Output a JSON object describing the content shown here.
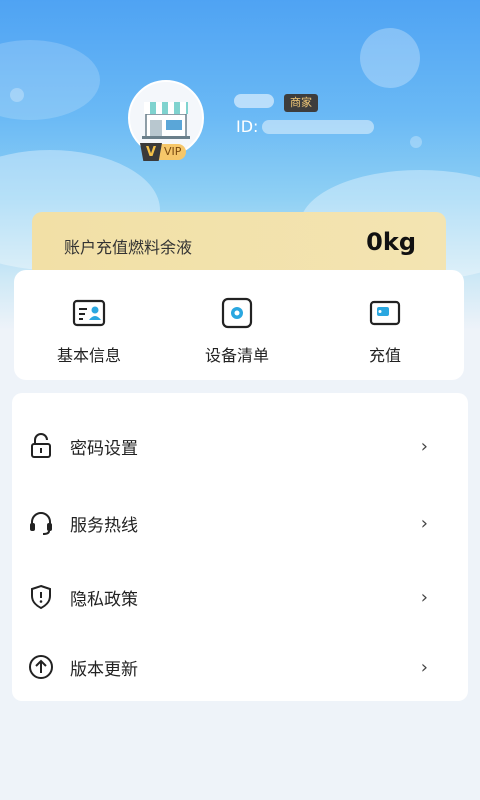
{
  "profile": {
    "role_tag": "商家",
    "id_label": "ID:",
    "vip_text": "VIP",
    "vip_letter": "V"
  },
  "fuel": {
    "label": "账户充值燃料余液",
    "value": "0kg"
  },
  "shortcuts": [
    {
      "label": "基本信息",
      "icon": "id-card-icon"
    },
    {
      "label": "设备清单",
      "icon": "gear-icon"
    },
    {
      "label": "充值",
      "icon": "wallet-icon"
    }
  ],
  "menu": [
    {
      "label": "密码设置",
      "icon": "lock-icon"
    },
    {
      "label": "服务热线",
      "icon": "headset-icon"
    },
    {
      "label": "隐私政策",
      "icon": "shield-icon"
    },
    {
      "label": "版本更新",
      "icon": "upload-icon"
    }
  ],
  "chevron": "›",
  "colors": {
    "hero_top": "#4fa3f3",
    "fuel_card": "#f2e0a6",
    "role_tag_bg": "#3d3d3d",
    "role_tag_text": "#f1c877",
    "icon_accent": "#2aa7e0"
  }
}
